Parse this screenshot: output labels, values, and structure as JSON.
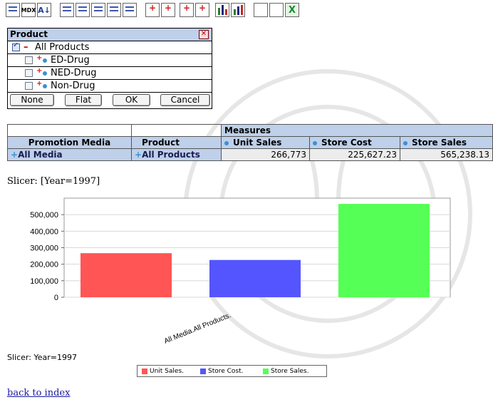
{
  "toolbar": {
    "mdx_label": "MDX",
    "sort_label": "A↓",
    "excel_label": "X"
  },
  "panel": {
    "title": "Product",
    "close_label": "✕",
    "items": [
      {
        "label": "All Products",
        "checked": true
      },
      {
        "label": "ED-Drug",
        "checked": false
      },
      {
        "label": "NED-Drug",
        "checked": false
      },
      {
        "label": "Non-Drug",
        "checked": false
      }
    ],
    "buttons": {
      "none": "None",
      "flat": "Flat",
      "ok": "OK",
      "cancel": "Cancel"
    }
  },
  "pivot": {
    "measures_label": "Measures",
    "col_promotion": "Promotion Media",
    "col_product": "Product",
    "measures": [
      "Unit Sales",
      "Store Cost",
      "Store Sales"
    ],
    "row": {
      "media": "All Media",
      "product": "All Products",
      "values": [
        "266,773",
        "225,627.23",
        "565,238.13"
      ]
    }
  },
  "slicer_text": "Slicer: [Year=1997]",
  "slicer_chart_text": "Slicer: Year=1997",
  "back_link": "back to index",
  "chart_data": {
    "type": "bar",
    "categories": [
      "All Media.All Products."
    ],
    "series": [
      {
        "name": "Unit Sales.",
        "values": [
          266773
        ],
        "color": "#ff5555"
      },
      {
        "name": "Store Cost.",
        "values": [
          225627.23
        ],
        "color": "#5555ff"
      },
      {
        "name": "Store Sales.",
        "values": [
          565238.13
        ],
        "color": "#55ff55"
      }
    ],
    "yticks": [
      "0",
      "100,000",
      "200,000",
      "300,000",
      "400,000",
      "500,000"
    ],
    "ylim": [
      0,
      600000
    ],
    "legend": "bottom"
  }
}
